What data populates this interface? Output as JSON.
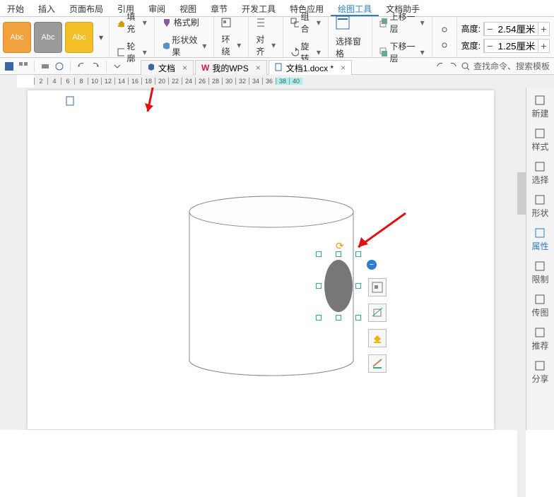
{
  "tabs": [
    "开始",
    "插入",
    "页面布局",
    "引用",
    "审阅",
    "视图",
    "章节",
    "开发工具",
    "特色应用",
    "绘图工具",
    "文档助手"
  ],
  "active_tab": 9,
  "ribbon": {
    "swatch_label": "Abc",
    "fill": "填充",
    "outline": "轮廓",
    "format_painter": "格式刷",
    "shape_effect": "形状效果",
    "wrap": "环绕",
    "align": "对齐",
    "group": "组合",
    "rotate": "旋转",
    "select_pane": "选择窗格",
    "bring_forward": "上移一层",
    "send_backward": "下移一层",
    "height_label": "高度:",
    "width_label": "宽度:",
    "height_value": "2.54厘米",
    "width_value": "1.25厘米"
  },
  "doc_tabs": [
    {
      "label": "文档",
      "icon": "cube",
      "active": false
    },
    {
      "label": "我的WPS",
      "icon": "w",
      "active": false
    },
    {
      "label": "文档1.docx *",
      "icon": "doc",
      "active": true
    }
  ],
  "search_placeholder": "查找命令、搜索模板",
  "ruler_marks": [
    "2",
    "4",
    "6",
    "8",
    "10",
    "12",
    "14",
    "16",
    "18",
    "20",
    "22",
    "24",
    "26",
    "28",
    "30",
    "32",
    "34",
    "36",
    "38",
    "40"
  ],
  "side_panel": [
    {
      "label": "新建",
      "icon": "new"
    },
    {
      "label": "样式",
      "icon": "style"
    },
    {
      "label": "选择",
      "icon": "select"
    },
    {
      "label": "形状",
      "icon": "shape"
    },
    {
      "label": "属性",
      "icon": "attr",
      "active": true
    },
    {
      "label": "限制",
      "icon": "limit"
    },
    {
      "label": "传图",
      "icon": "upload"
    },
    {
      "label": "推荐",
      "icon": "star"
    },
    {
      "label": "分享",
      "icon": "share"
    }
  ],
  "float_tools": [
    "wrap",
    "crop",
    "fill",
    "effect"
  ],
  "colors": {
    "accent": "#2b7cd3",
    "orange": "#f2a13c",
    "yellow": "#f4c027",
    "gray": "#9a9a9a"
  }
}
